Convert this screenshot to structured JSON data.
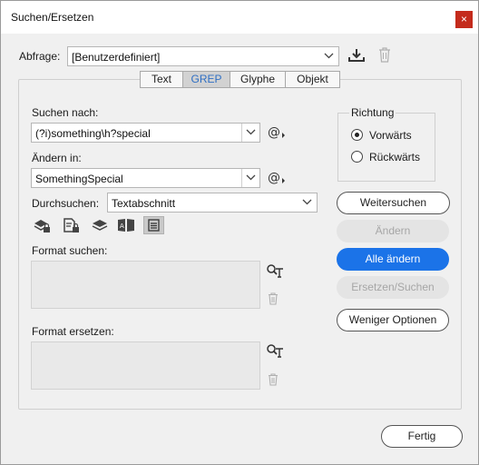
{
  "window": {
    "title": "Suchen/Ersetzen",
    "close_label": "×"
  },
  "query": {
    "label": "Abfrage:",
    "value": "[Benutzerdefiniert]"
  },
  "tabs": [
    {
      "label": "Text"
    },
    {
      "label": "GREP"
    },
    {
      "label": "Glyphe"
    },
    {
      "label": "Objekt"
    }
  ],
  "find": {
    "label": "Suchen nach:",
    "value": "(?i)something\\h?special"
  },
  "change": {
    "label": "Ändern in:",
    "value": "SomethingSpecial"
  },
  "search_in": {
    "label": "Durchsuchen:",
    "value": "Textabschnitt"
  },
  "format_find": {
    "label": "Format suchen:"
  },
  "format_replace": {
    "label": "Format ersetzen:"
  },
  "direction": {
    "title": "Richtung",
    "forward": "Vorwärts",
    "backward": "Rückwärts"
  },
  "buttons": {
    "find_next": "Weitersuchen",
    "change": "Ändern",
    "change_all": "Alle ändern",
    "change_find": "Ersetzen/Suchen",
    "fewer_options": "Weniger Optionen",
    "done": "Fertig"
  },
  "colors": {
    "accent": "#1b73e8",
    "tab_active_text": "#2f6fc4",
    "close": "#c42b1c"
  }
}
